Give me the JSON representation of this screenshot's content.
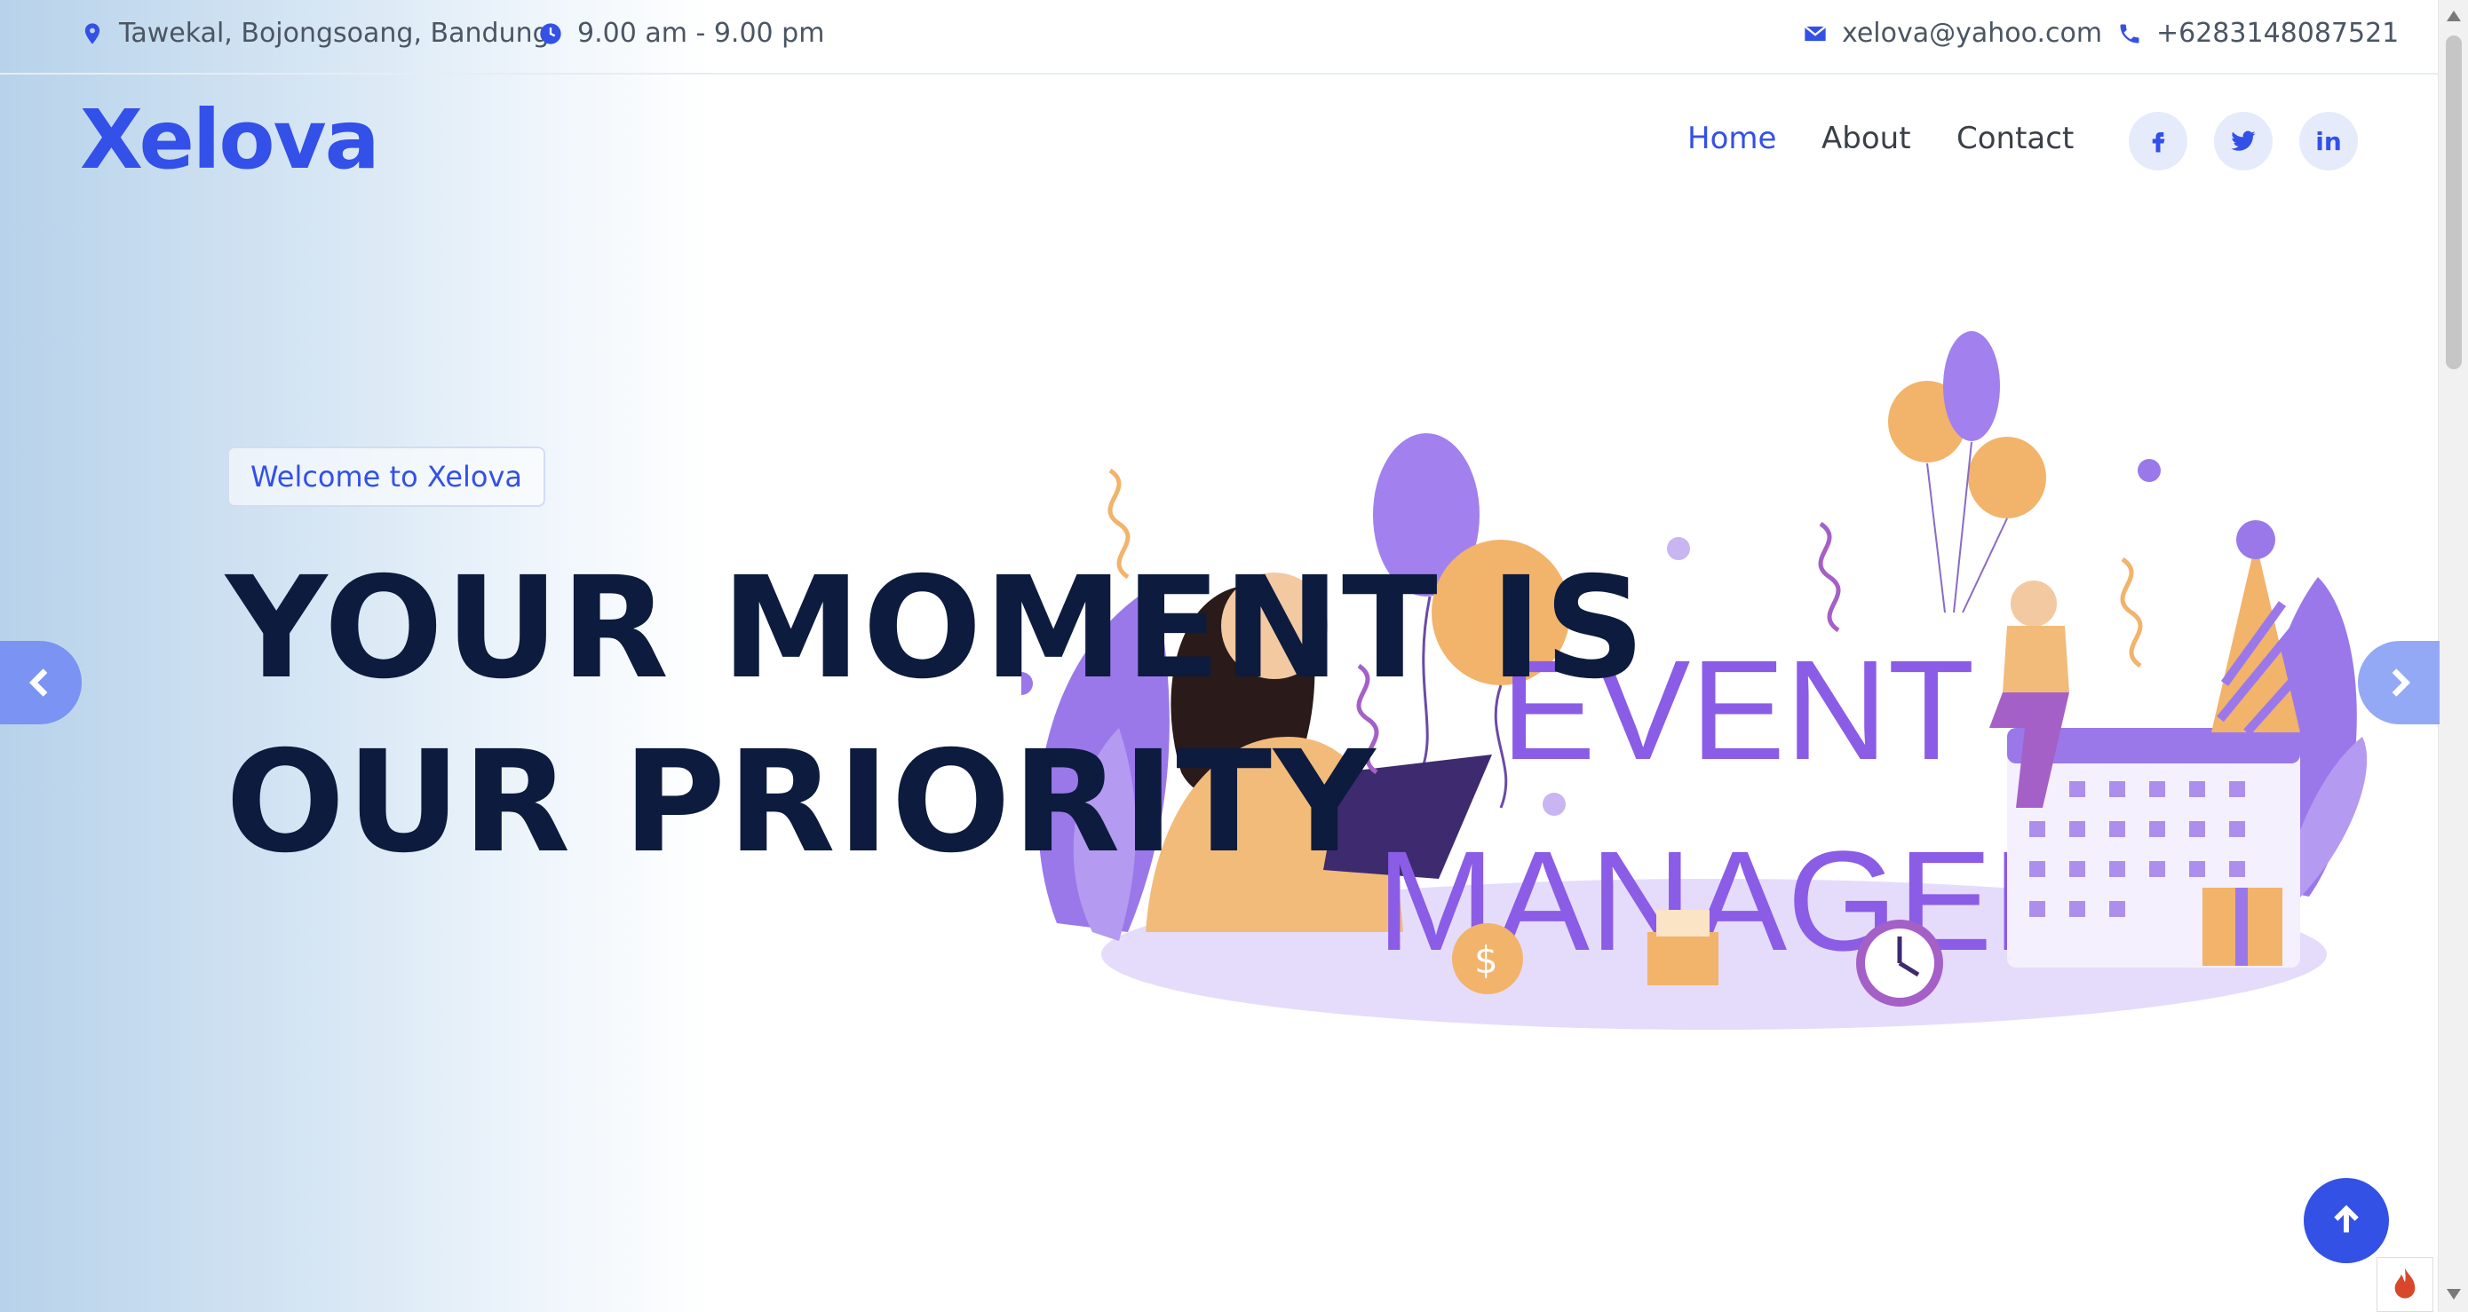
{
  "topbar": {
    "address": "Tawekal, Bojongsoang, Bandung",
    "hours": "9.00 am - 9.00 pm",
    "email": "xelova@yahoo.com",
    "phone": "+6283148087521",
    "icons": [
      "location-icon",
      "clock-icon",
      "envelope-icon",
      "phone-icon"
    ]
  },
  "header": {
    "logo": "Xelova",
    "nav": [
      {
        "label": "Home",
        "active": true
      },
      {
        "label": "About",
        "active": false
      },
      {
        "label": "Contact",
        "active": false
      }
    ],
    "social": [
      "facebook-icon",
      "twitter-icon",
      "linkedin-icon"
    ]
  },
  "hero": {
    "badge": "Welcome to Xelova",
    "headline_line1": "YOUR MOMENT IS",
    "headline_line2": "OUR PRIORITY",
    "illustration_text_line1": "EVENT",
    "illustration_text_line2": "MANAGER"
  },
  "colors": {
    "accent": "#3350e8",
    "headline": "#0d1b3e",
    "illustration_purple": "#8b5ce6",
    "illustration_orange": "#f2b36b"
  }
}
